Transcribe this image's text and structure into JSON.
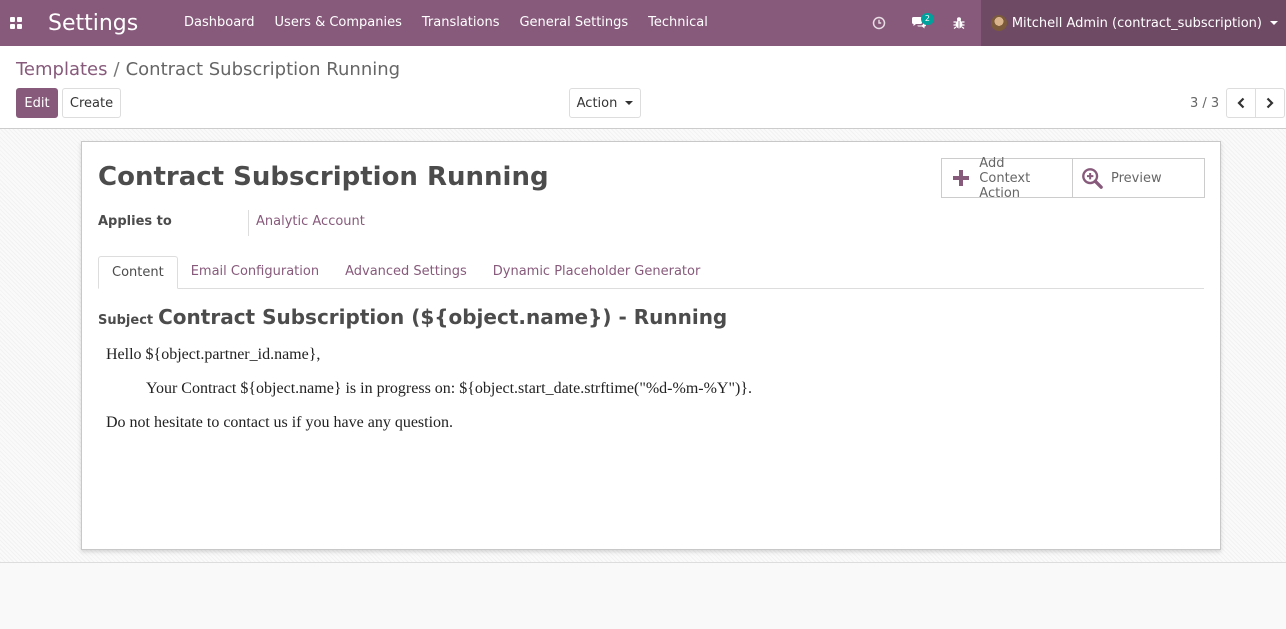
{
  "navbar": {
    "brand": "Settings",
    "menu": [
      "Dashboard",
      "Users & Companies",
      "Translations",
      "General Settings",
      "Technical"
    ],
    "messages_badge": "2",
    "user_name": "Mitchell Admin (contract_subscription)",
    "icons": [
      "apps-grid-icon",
      "clock-icon",
      "chat-icon",
      "bug-icon"
    ],
    "color": "#875a7b"
  },
  "breadcrumb": {
    "parent": "Templates",
    "separator": "/",
    "current": "Contract Subscription Running"
  },
  "toolbar": {
    "edit_label": "Edit",
    "create_label": "Create",
    "action_label": "Action"
  },
  "pager": {
    "value": "3 / 3"
  },
  "form": {
    "title": "Contract Subscription Running",
    "smart_buttons": {
      "add_line1": "Add",
      "add_line2": "Context Action",
      "preview": "Preview"
    },
    "applies_to_label": "Applies to",
    "applies_to_value": "Analytic Account",
    "tabs": [
      "Content",
      "Email Configuration",
      "Advanced Settings",
      "Dynamic Placeholder Generator"
    ],
    "active_tab": "Content",
    "subject_label": "Subject",
    "subject_value": "Contract Subscription (${object.name}) - Running",
    "body": {
      "line1": "Hello ${object.partner_id.name},",
      "line2": "Your Contract ${object.name} is in progress on: ${object.start_date.strftime(\"%d-%m-%Y\")}.",
      "line3": "Do not hesitate to contact us if you have any question."
    }
  }
}
